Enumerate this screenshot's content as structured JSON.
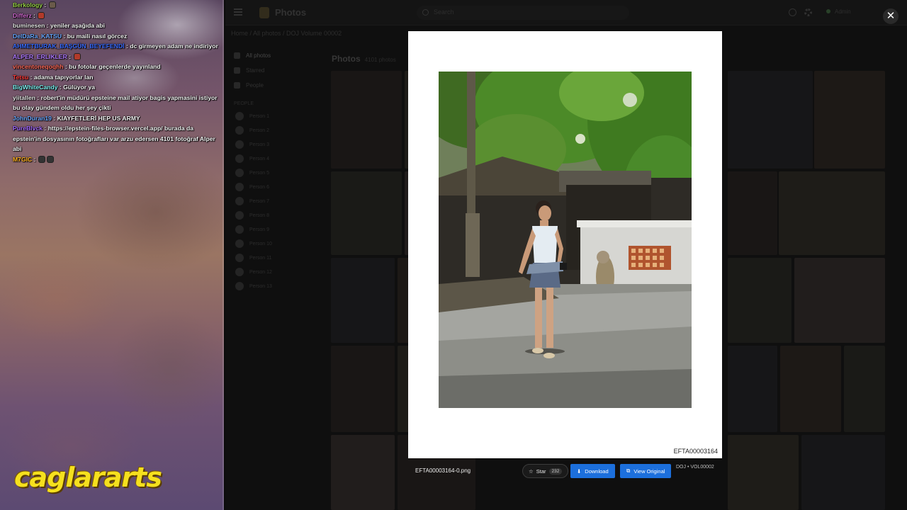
{
  "chat": {
    "messages": [
      {
        "user": "Berkology",
        "color": "#9ad24a",
        "text": ""
      },
      {
        "user": "Differz",
        "color": "#d06ad0",
        "text": ""
      },
      {
        "user": "buminesen",
        "color": "#e6e6e6",
        "text": "yeniler aşağıda abi"
      },
      {
        "user": "DelDaRa_KATSU",
        "color": "#6aa8ff",
        "text": "bu maili nasıl görcez"
      },
      {
        "user": "AHMETBURAK_BAŞGÜN_BEYEFENDİ",
        "color": "#3a6cff",
        "text": "dc girmeyen adam ne indiriyor"
      },
      {
        "user": "ALPER_ERLIKLER",
        "color": "#b07aff",
        "text": ""
      },
      {
        "user": "vincentoneqoqhh",
        "color": "#ff6a5a",
        "text": "bu fotolar geçenlerde yayınland"
      },
      {
        "user": "Tetsu",
        "color": "#ff3a3a",
        "text": "adama tapıyorlar lan"
      },
      {
        "user": "BigWhiteCandy",
        "color": "#7cf0f0",
        "text": "Gülüyor ya"
      },
      {
        "user": "yiitallen",
        "color": "#e6e6e6",
        "text": "robert'in müdürü epsteine mail atiyor bagis yapmasini istiyor bu olay gündem oldu her şey çikti"
      },
      {
        "user": "JohnDuran19",
        "color": "#6aa8ff",
        "text": "KIAYFETLERİ HEP US ARMY"
      },
      {
        "user": "PureBlvck",
        "color": "#a46aff",
        "text": "https://epstein-files-browser.vercel.app/ burada da epstein'in dosyasının fotoğrafları var arzu edersen 4101 fotoğraf Alper abi"
      },
      {
        "user": "M7GIC",
        "color": "#ffb020",
        "text": ""
      }
    ]
  },
  "brand": {
    "name": "caglararts"
  },
  "app": {
    "logo_text": "Photos",
    "search_placeholder": "Search",
    "user_label": "Admin",
    "breadcrumb": "Home / All photos / DOJ Volume 00002",
    "nav": [
      {
        "label": "All photos"
      },
      {
        "label": "Starred"
      },
      {
        "label": "People"
      }
    ],
    "section_label": "PEOPLE",
    "people": [
      "Person 1",
      "Person 2",
      "Person 3",
      "Person 4",
      "Person 5",
      "Person 6",
      "Person 7",
      "Person 8",
      "Person 9",
      "Person 10",
      "Person 11",
      "Person 12",
      "Person 13"
    ],
    "content_title": "Photos",
    "content_count": "4101 photos"
  },
  "viewer": {
    "close_glyph": "✕",
    "photo_id": "EFTA00003164",
    "file_name": "EFTA00003164-0.png",
    "star_label": "Star",
    "star_count": "232",
    "download_label": "Download",
    "view_original_label": "View Original",
    "collection": "DOJ • VOL00002",
    "accent_color": "#1c6fdc"
  }
}
